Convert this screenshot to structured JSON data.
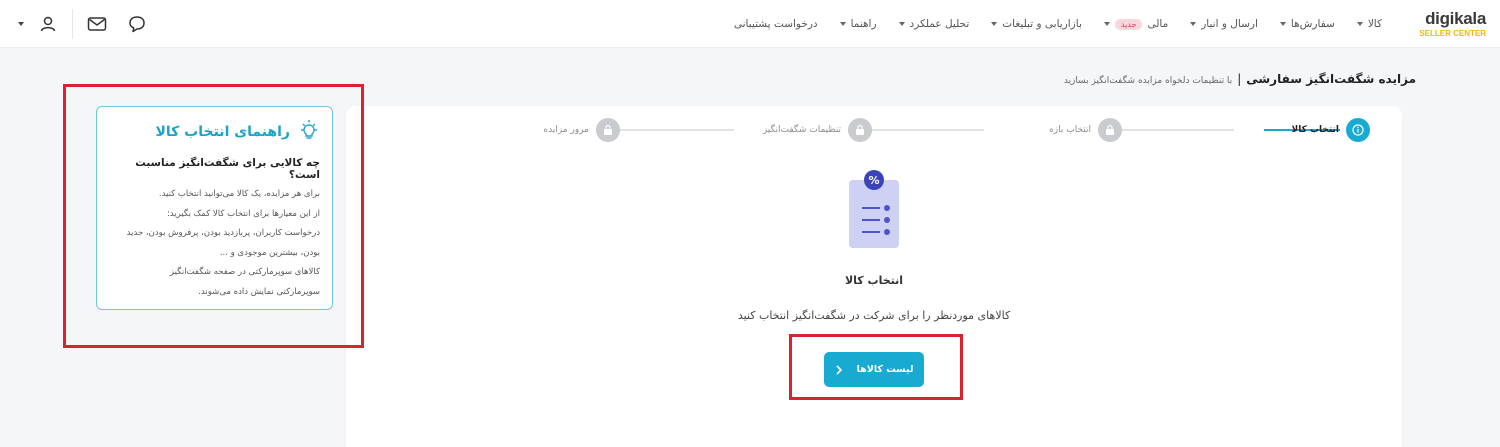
{
  "brand": {
    "name": "digikala",
    "sub": "SELLER CENTER"
  },
  "nav": {
    "items": [
      {
        "label": "کالا",
        "caret": true
      },
      {
        "label": "سفارش‌ها",
        "caret": true
      },
      {
        "label": "ارسال و انبار",
        "caret": true
      },
      {
        "label": "مالی",
        "badge": "جدید",
        "caret": true
      },
      {
        "label": "بازاریابی و تبلیغات",
        "caret": true
      },
      {
        "label": "تحلیل عملکرد",
        "caret": true
      },
      {
        "label": "راهنما",
        "caret": true
      },
      {
        "label": "درخواست پشتیبانی",
        "caret": false
      }
    ]
  },
  "header_icons": [
    "chat-icon",
    "mail-icon",
    "user-icon",
    "caret-down-icon"
  ],
  "breadcrumb": {
    "title": "مزایده شگفت‌انگیز سفارشی",
    "separator": "|",
    "description": "با تنظیمات دلخواه مزایده شگفت‌انگیز بسازید"
  },
  "stepper": {
    "steps": [
      {
        "label": "انتخاب کالا",
        "state": "active",
        "icon": "info-icon"
      },
      {
        "label": "انتخاب بازه",
        "state": "locked",
        "icon": "lock-icon"
      },
      {
        "label": "تنظیمات شگفت‌انگیز",
        "state": "locked",
        "icon": "lock-icon"
      },
      {
        "label": "مرور مزایده",
        "state": "locked",
        "icon": "lock-icon"
      }
    ]
  },
  "empty_state": {
    "title": "انتخاب کالا",
    "description": "کالاهای موردنظر را برای شرکت در شگفت‌انگیز انتخاب کنید",
    "button_label": "لیست کالاها",
    "illustration": "checklist-percent-icon"
  },
  "guide": {
    "title": "راهنمای انتخاب کالا",
    "question": "چه کالایی برای شگفت‌انگیز مناسبت است؟",
    "lines": [
      "برای هر مزایده، یک کالا می‌توانید انتخاب کنید.",
      "از این معیارها برای انتخاب کالا کمک بگیرید:",
      "درخواست کاربران، پربازدید بودن، پرفروش بودن، جدید",
      "بودن، بیشترین موجودی و ...",
      "کالاهای سوپرمارکتی در صفحه شگفت‌انگیز",
      "سوپرمارکتی نمایش داده می‌شوند."
    ],
    "icon": "lightbulb-icon"
  },
  "colors": {
    "accent": "#19aad1",
    "highlight": "#d9232e",
    "brand_yellow": "#f2b705",
    "badge_bg": "#f7d6dc",
    "badge_text": "#d64560"
  }
}
